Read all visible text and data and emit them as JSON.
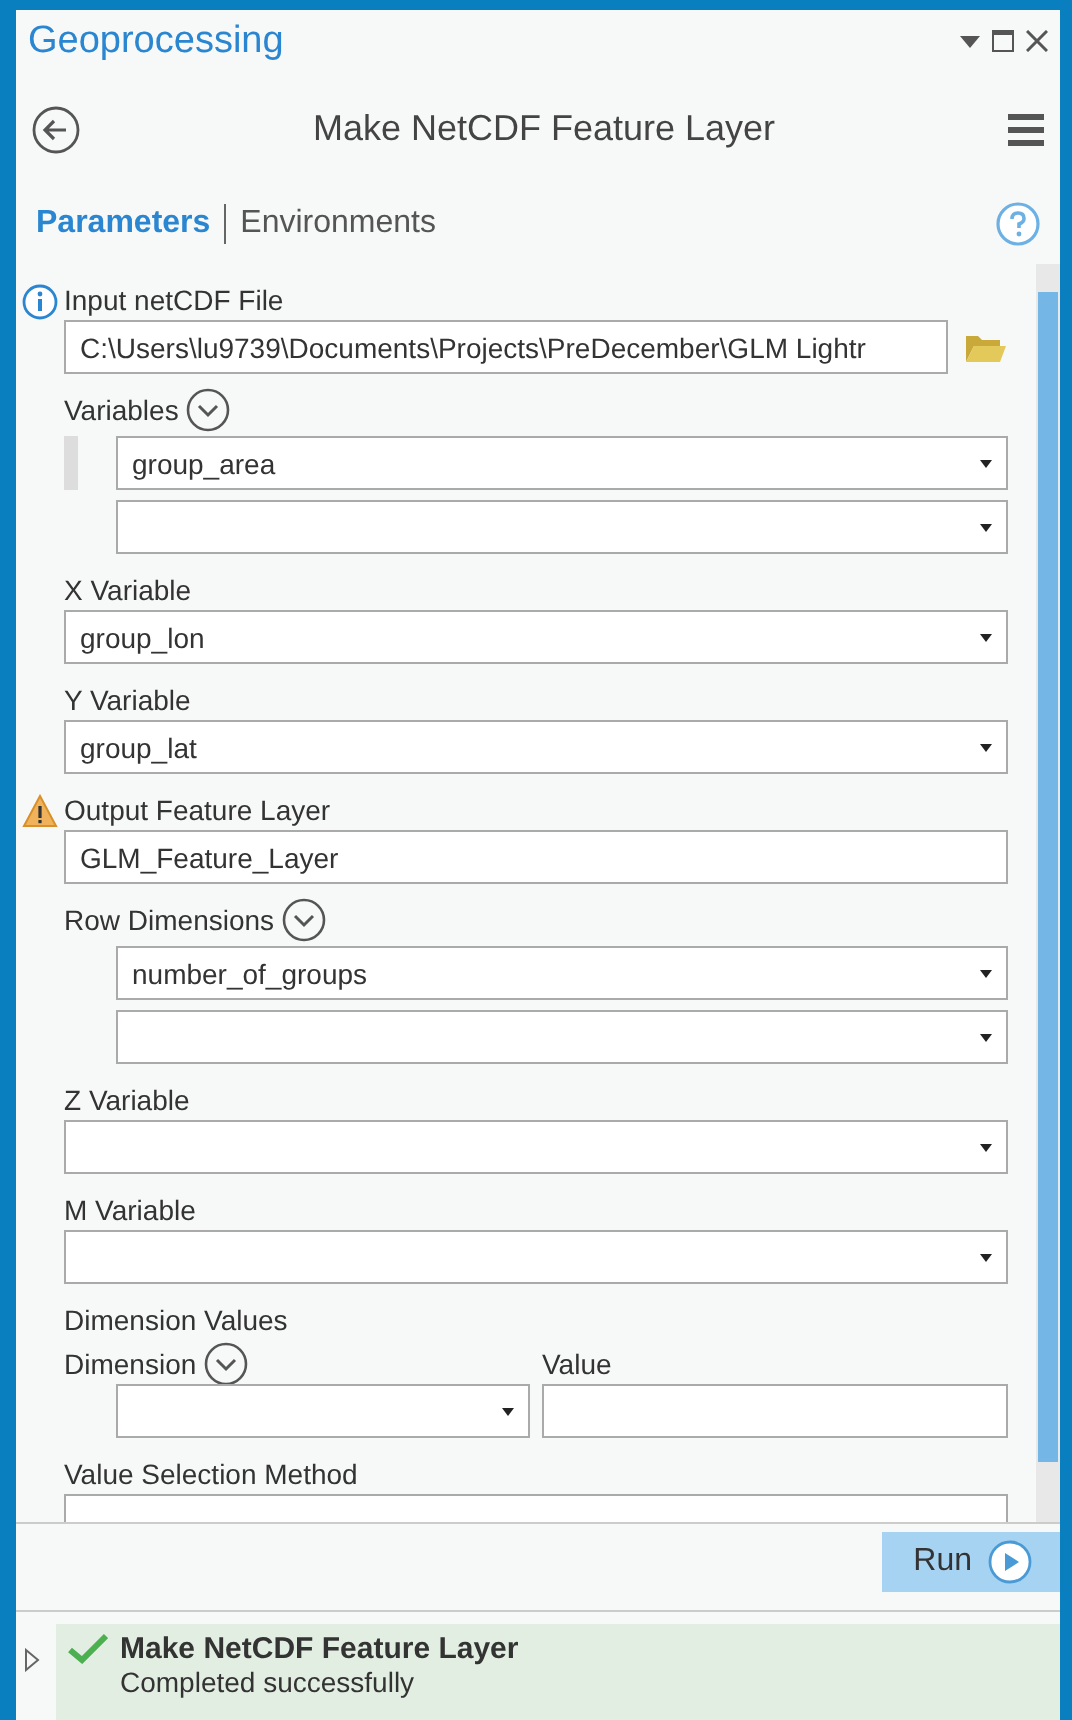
{
  "pane": {
    "title": "Geoprocessing"
  },
  "tool": {
    "title": "Make NetCDF Feature Layer"
  },
  "tabs": [
    {
      "label": "Parameters",
      "selected": true
    },
    {
      "label": "Environments",
      "selected": false
    }
  ],
  "parameters": [
    {
      "kind": "file",
      "label": "Input netCDF File",
      "info": true,
      "warning": false,
      "value": "C:\\Users\\lu9739\\Documents\\Projects\\PreDecember\\GLM Lightr"
    },
    {
      "kind": "multi",
      "label": "Variables",
      "info": false,
      "warning": false,
      "rows": [
        {
          "value": "group_area",
          "selected": true
        },
        {
          "selected": false
        }
      ]
    },
    {
      "kind": "dropdown",
      "label": "X Variable",
      "info": false,
      "warning": false,
      "value": "group_lon"
    },
    {
      "kind": "dropdown",
      "label": "Y Variable",
      "info": false,
      "warning": false,
      "value": "group_lat"
    },
    {
      "kind": "text",
      "label": "Output Feature Layer",
      "info": false,
      "warning": true,
      "value": "GLM_Feature_Layer"
    },
    {
      "kind": "multi",
      "label": "Row Dimensions",
      "info": false,
      "warning": false,
      "rows": [
        {
          "value": "number_of_groups",
          "selected": false
        },
        {
          "selected": false
        }
      ]
    },
    {
      "kind": "dropdown",
      "label": "Z Variable",
      "info": false,
      "warning": false
    },
    {
      "kind": "dropdown",
      "label": "M Variable",
      "info": false,
      "warning": false
    },
    {
      "kind": "table",
      "label": "Dimension Values",
      "info": false,
      "warning": false,
      "columns": [
        {
          "label": "Dimension",
          "kind": "dropdown"
        },
        {
          "label": "Value",
          "kind": "text"
        }
      ]
    },
    {
      "kind": "text",
      "label": "Value Selection Method",
      "info": false,
      "warning": false
    }
  ],
  "run_button": {
    "label": "Run"
  },
  "message": {
    "title": "Make NetCDF Feature Layer",
    "detail": "Completed successfully",
    "succeeded": true
  }
}
